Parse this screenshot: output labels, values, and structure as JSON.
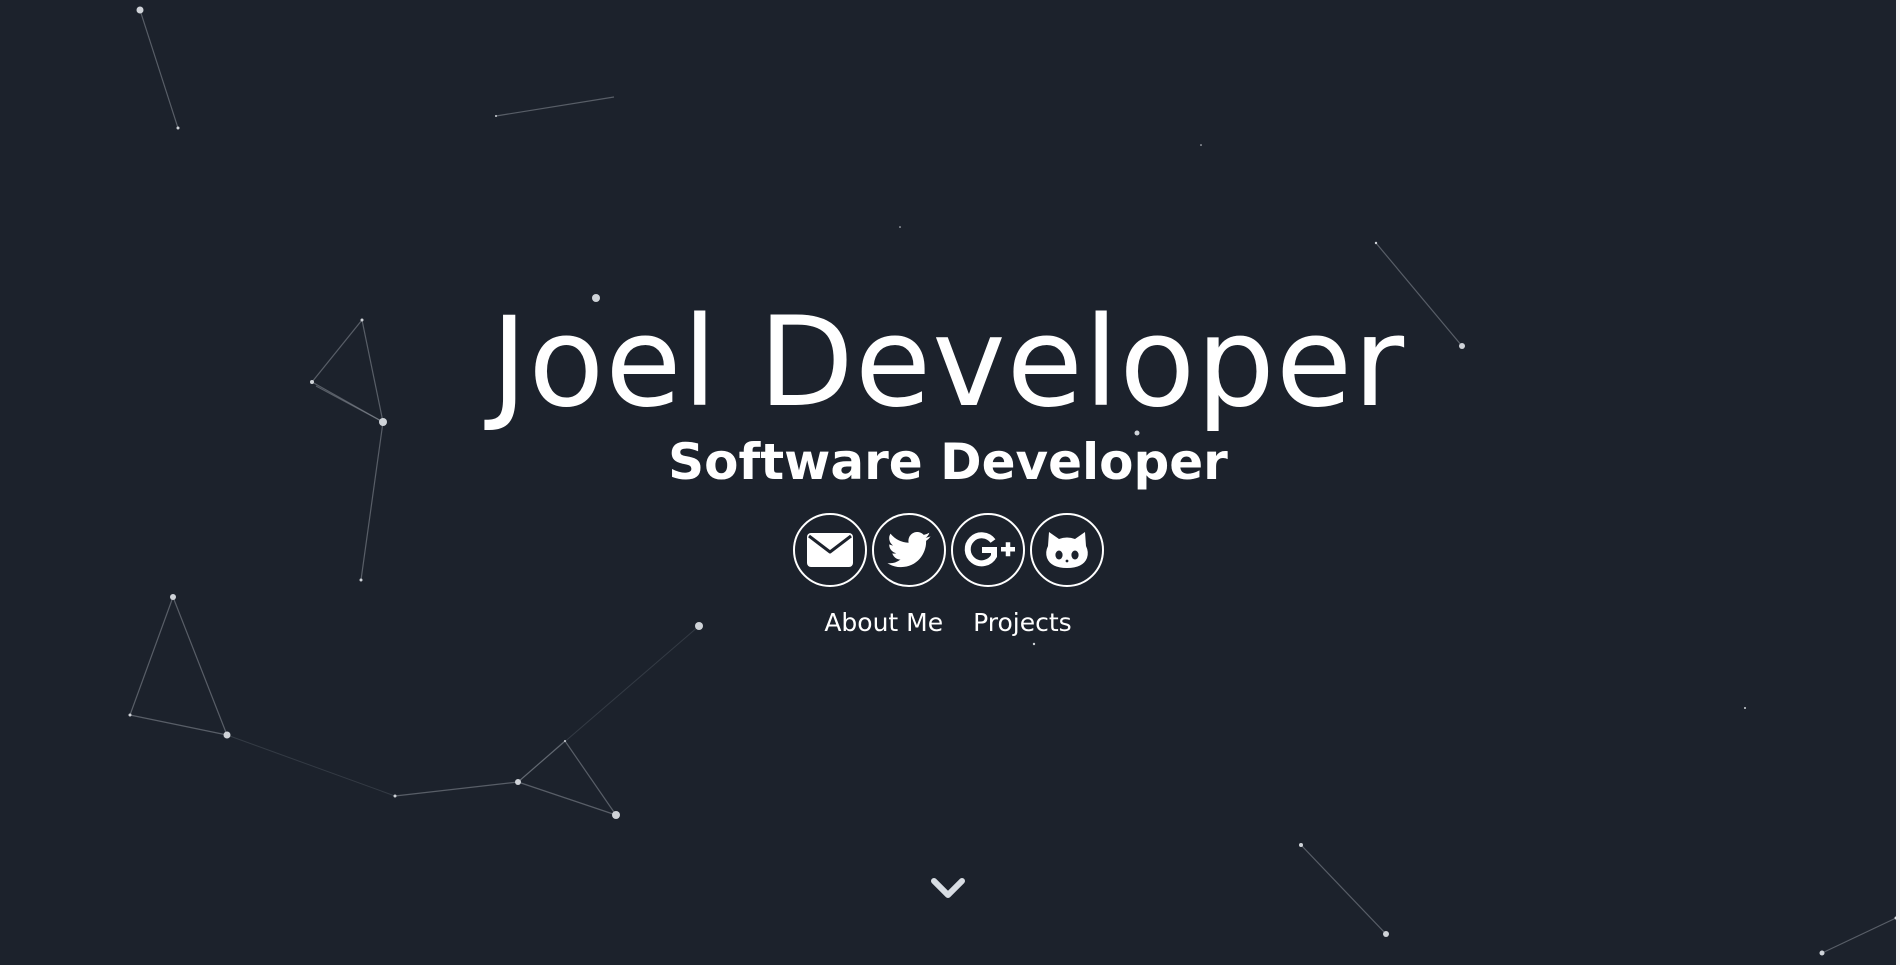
{
  "hero": {
    "name": "Joel Developer",
    "tagline": "Software Developer"
  },
  "social": [
    {
      "name": "email",
      "icon": "envelope-icon"
    },
    {
      "name": "twitter",
      "icon": "twitter-bird-icon"
    },
    {
      "name": "google-plus",
      "icon": "google-plus-icon"
    },
    {
      "name": "github",
      "icon": "github-octocat-icon"
    }
  ],
  "nav": {
    "about_label": "About Me",
    "projects_label": "Projects"
  },
  "scroll": {
    "icon": "chevron-down-icon"
  },
  "colors": {
    "background": "#1c222c",
    "foreground": "#ffffff",
    "particle": "#8a9099"
  }
}
